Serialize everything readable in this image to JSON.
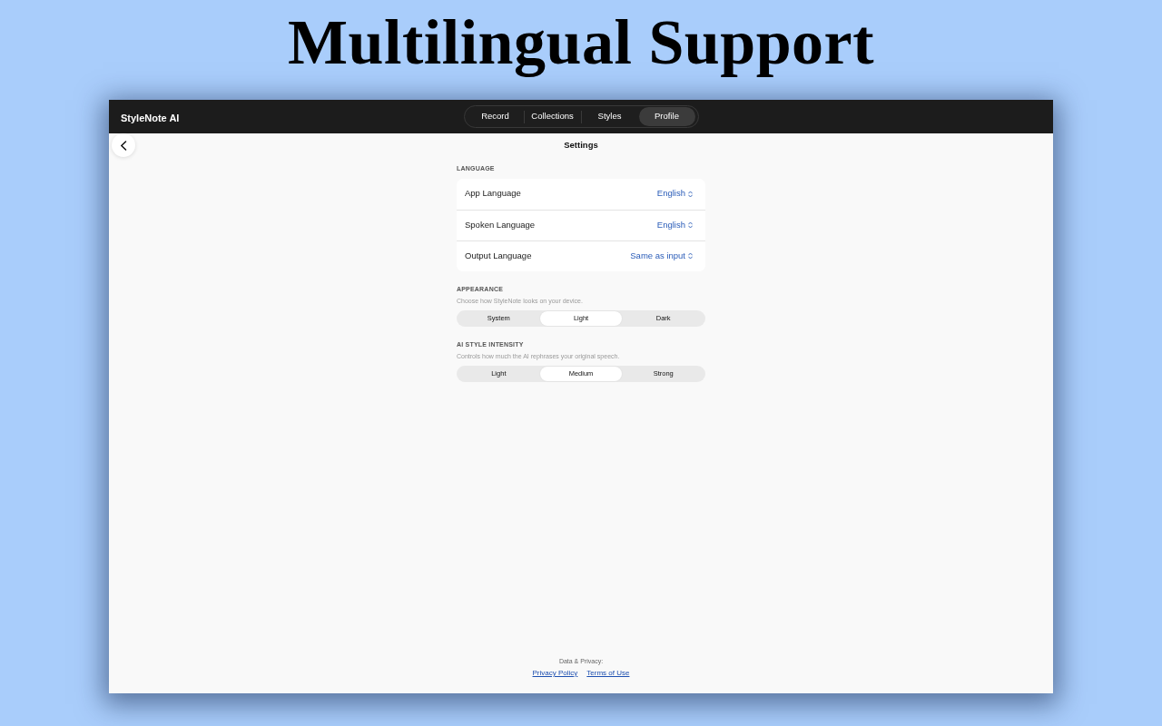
{
  "headline": "Multilingual Support",
  "window": {
    "app_name": "StyleNote AI",
    "tabs": [
      {
        "label": "Record",
        "selected": false
      },
      {
        "label": "Collections",
        "selected": false
      },
      {
        "label": "Styles",
        "selected": false
      },
      {
        "label": "Profile",
        "selected": true
      }
    ],
    "page_title": "Settings"
  },
  "sections": [
    {
      "kind": "list",
      "heading": "LANGUAGE",
      "rows": [
        {
          "label": "App Language",
          "value": "English"
        },
        {
          "label": "Spoken Language",
          "value": "English"
        },
        {
          "label": "Output Language",
          "value": "Same as input"
        }
      ]
    },
    {
      "kind": "segmented",
      "heading": "APPEARANCE",
      "description": "Choose how StyleNote looks on your device.",
      "options": [
        {
          "label": "System",
          "selected": false
        },
        {
          "label": "Light",
          "selected": true
        },
        {
          "label": "Dark",
          "selected": false
        }
      ]
    },
    {
      "kind": "segmented",
      "heading": "AI STYLE INTENSITY",
      "description": "Controls how much the AI rephrases your original speech.",
      "options": [
        {
          "label": "Light",
          "selected": false
        },
        {
          "label": "Medium",
          "selected": true
        },
        {
          "label": "Strong",
          "selected": false
        }
      ]
    }
  ],
  "footer": {
    "label": "Data & Privacy:",
    "links": [
      "Privacy Policy",
      "Terms of Use"
    ]
  }
}
